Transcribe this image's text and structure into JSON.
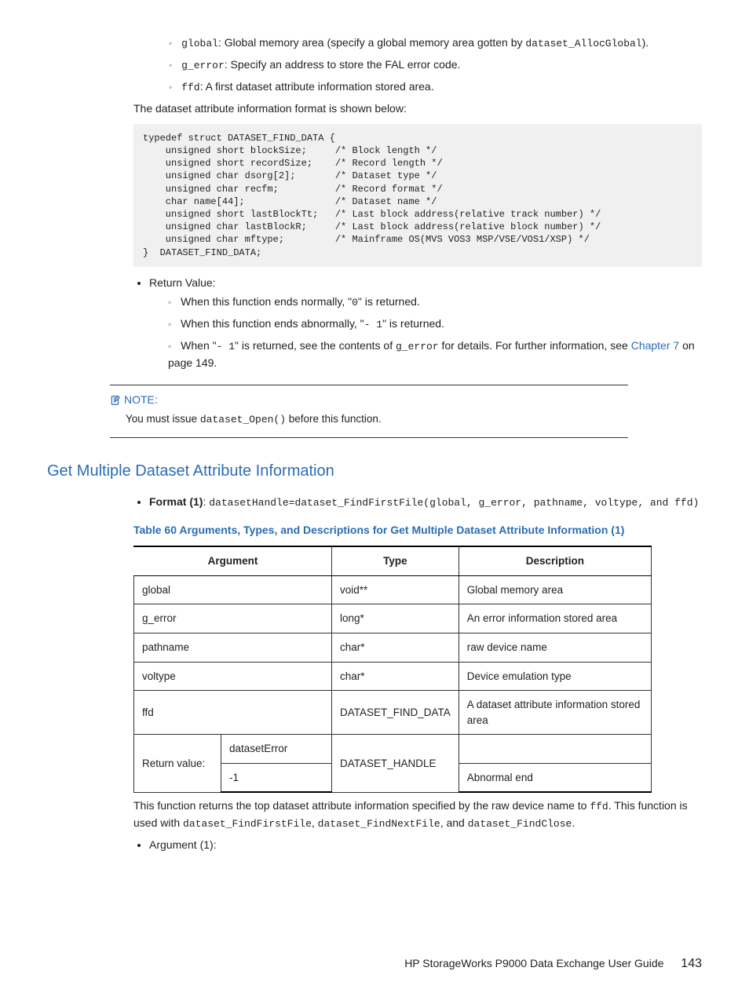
{
  "top_bullets": [
    {
      "code": "global",
      "rest": ": Global memory area (specify a global memory area gotten by ",
      "code2": "dataset_AllocGlobal",
      "rest2": ")."
    },
    {
      "code": "g_error",
      "rest": ": Specify an address to store the FAL error code."
    },
    {
      "code": "ffd",
      "rest": ": A first dataset attribute information stored area."
    }
  ],
  "para_attr": "The dataset attribute information format is shown below:",
  "codeblock": "typedef struct DATASET_FIND_DATA {\n    unsigned short blockSize;     /* Block length */\n    unsigned short recordSize;    /* Record length */\n    unsigned char dsorg[2];       /* Dataset type */\n    unsigned char recfm;          /* Record format */\n    char name[44];                /* Dataset name */\n    unsigned short lastBlockTt;   /* Last block address(relative track number) */\n    unsigned char lastBlockR;     /* Last block address(relative block number) */\n    unsigned char mftype;         /* Mainframe OS(MVS VOS3 MSP/VSE/VOS1/XSP) */\n}  DATASET_FIND_DATA;",
  "return_label": "Return Value:",
  "return_items": {
    "r1a": "When this function ends normally, \"",
    "r1code": "0",
    "r1b": "\" is returned.",
    "r2a": "When this function ends abnormally, \"",
    "r2code": "- 1",
    "r2b": "\" is returned.",
    "r3a": "When \"",
    "r3code": "- 1",
    "r3b": "\" is returned, see the contents of ",
    "r3code2": "g_error",
    "r3c": " for details. For further information, see ",
    "r3link": "Chapter 7",
    "r3d": " on page 149."
  },
  "note": {
    "head": "NOTE:",
    "body_a": "You must issue ",
    "body_code": "dataset_Open()",
    "body_b": " before this function."
  },
  "section_title": "Get Multiple Dataset Attribute Information",
  "format1": {
    "label": "Format (1)",
    "sep": ": ",
    "code": "datasetHandle=dataset_FindFirstFile(global, g_error, pathname, voltype, and ffd)"
  },
  "table_caption": "Table 60 Arguments, Types, and Descriptions for Get Multiple Dataset Attribute Information (1)",
  "table": {
    "headers": [
      "Argument",
      "Type",
      "Description"
    ],
    "rows": [
      {
        "arg": "global",
        "type": "void**",
        "desc": "Global memory area"
      },
      {
        "arg": "g_error",
        "type": "long*",
        "desc": "An error information stored area"
      },
      {
        "arg": "pathname",
        "type": "char*",
        "desc": "raw device name"
      },
      {
        "arg": "voltype",
        "type": "char*",
        "desc": "Device emulation type"
      },
      {
        "arg": "ffd",
        "type": "DATASET_FIND_DATA",
        "desc": "A dataset attribute information stored area"
      }
    ],
    "return_label": "Return value:",
    "return_rows": [
      {
        "arg": "datasetError",
        "type": "DATASET_HANDLE",
        "desc": ""
      },
      {
        "arg": "-1",
        "type": "",
        "desc": "Abnormal end"
      }
    ]
  },
  "para_after_a": "This function returns the top dataset attribute information specified by the raw device name to ",
  "para_after_code1": "ffd",
  "para_after_b": ". This function is used with ",
  "para_after_code2": "dataset_FindFirstFile",
  "para_after_c": ", ",
  "para_after_code3": "dataset_FindNextFile",
  "para_after_d": ", and ",
  "para_after_code4": "dataset_FindClose",
  "para_after_e": ".",
  "argument1": "Argument (1):",
  "footer": {
    "title": "HP StorageWorks P9000 Data Exchange User Guide",
    "page": "143"
  }
}
